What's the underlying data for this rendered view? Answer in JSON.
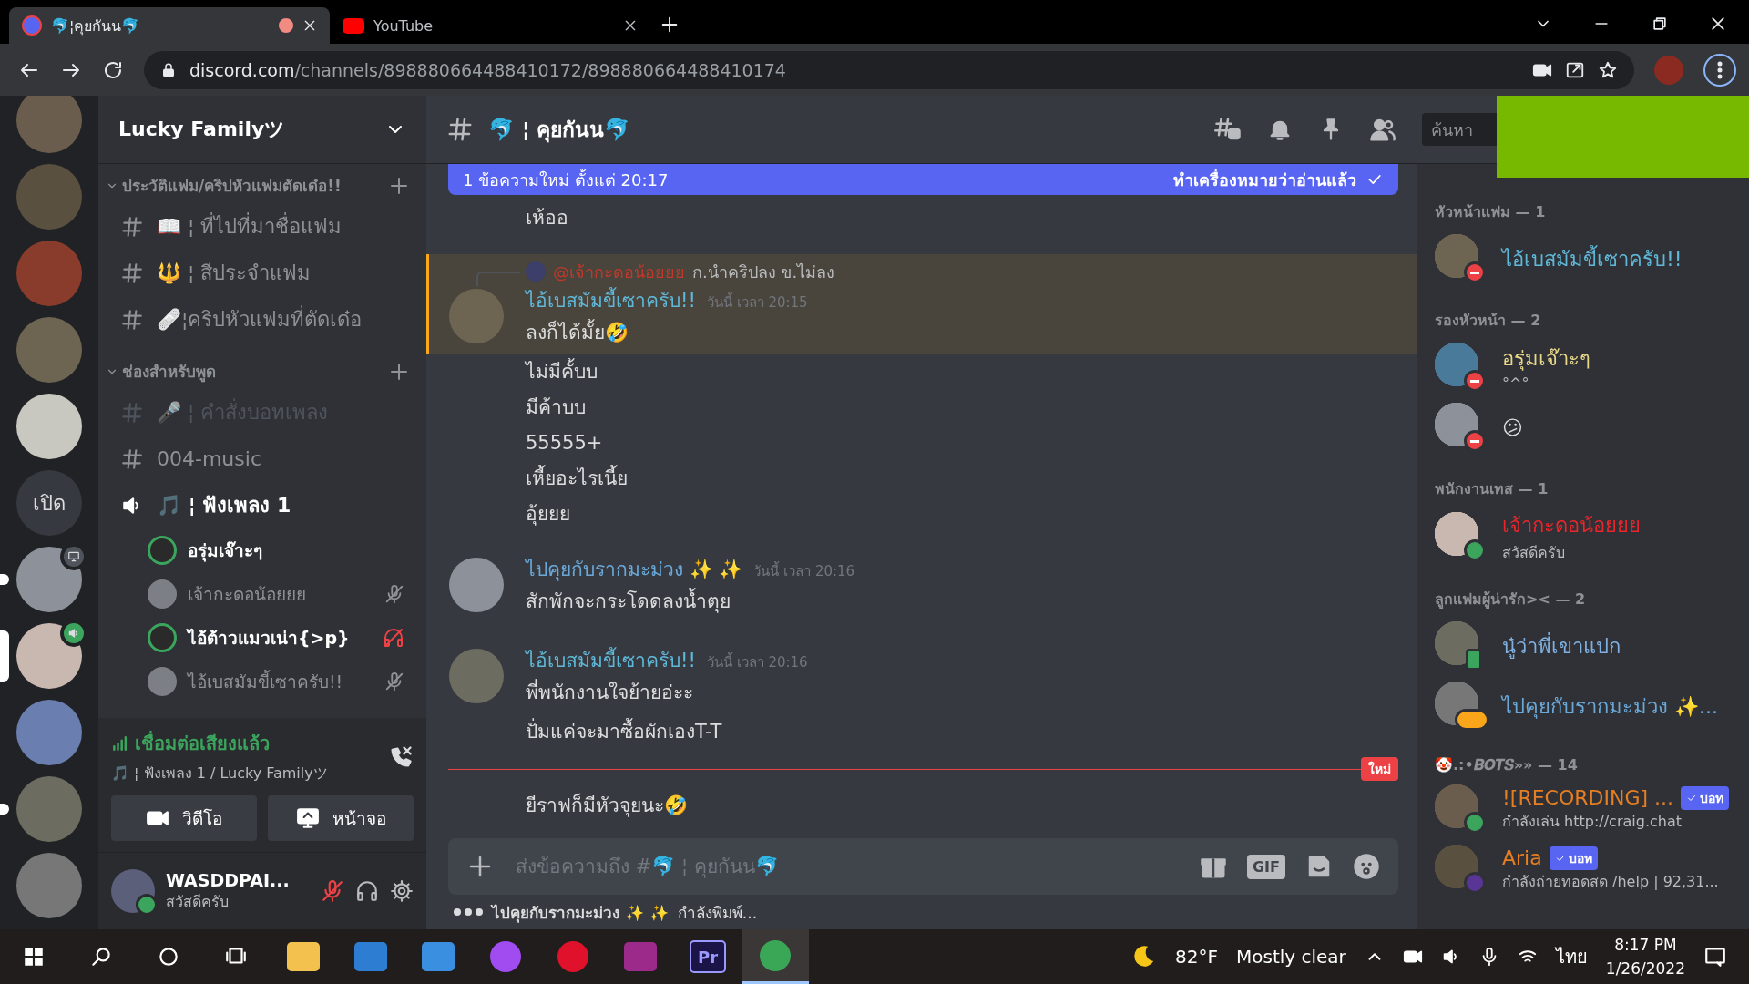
{
  "browser": {
    "tabs": [
      {
        "favicon": {
          "kind": "discord"
        },
        "title": "🐬¦คุยกันน🐬",
        "selected": true,
        "recording": true
      },
      {
        "favicon": {
          "kind": "youtube"
        },
        "title": "YouTube",
        "selected": false,
        "recording": false
      }
    ],
    "url": {
      "domain": "discord.com",
      "path": "/channels/898880664488410172/898880664488410174"
    }
  },
  "servers": [
    {
      "kind": "avatar",
      "unread": false,
      "selected": false
    },
    {
      "kind": "avatar",
      "unread": false,
      "selected": false
    },
    {
      "kind": "avatar",
      "unread": false,
      "selected": false
    },
    {
      "kind": "avatar",
      "unread": false,
      "selected": false
    },
    {
      "kind": "avatar",
      "unread": false,
      "selected": false
    },
    {
      "kind": "text",
      "label": "เปิด",
      "unread": false,
      "selected": false
    },
    {
      "kind": "avatar",
      "badge": {
        "kind": "screen"
      },
      "unread": true,
      "selected": false
    },
    {
      "kind": "avatar",
      "badge": {
        "kind": "voice"
      },
      "unread": false,
      "selected": true
    },
    {
      "kind": "avatar",
      "unread": false,
      "selected": false
    },
    {
      "kind": "avatar",
      "unread": true,
      "selected": false
    },
    {
      "kind": "avatar",
      "unread": false,
      "selected": false
    }
  ],
  "server": {
    "name": "Lucky Familyツ"
  },
  "categories": [
    {
      "name": "ประวัติแฟม/คริปหัวแฟมตัดเด๋อ!!",
      "expanded": true,
      "channels": [
        {
          "kind": "text",
          "name": "📖 ¦ ที่ไปที่มาชื่อแฟม",
          "muted": false
        },
        {
          "kind": "text",
          "name": "🔱 ¦ สีประจำแฟม",
          "muted": false
        },
        {
          "kind": "text",
          "name": "🩹¦คริปหัวแฟมที่ตัดเด๋อ",
          "muted": false
        }
      ]
    },
    {
      "name": "ช่องสำหรับพูด",
      "expanded": true,
      "channels": [
        {
          "kind": "text",
          "name": "🎤 ¦ คำสั่งบอทเพลง",
          "muted": true
        },
        {
          "kind": "text",
          "name": "004-music",
          "muted": false
        },
        {
          "kind": "voice",
          "name": "🎵 ¦ ฟังเพลง 1",
          "muted": false,
          "users": [
            {
              "name": "อรุ่มเจ๊าะๆ",
              "speaking": true,
              "muted": false,
              "deafened": false
            },
            {
              "name": "เจ้ากะดอน้อยยย",
              "speaking": false,
              "muted": true,
              "deafened": false
            },
            {
              "name": "ไอ้ต้าวแมวเน่า{>p}",
              "speaking": true,
              "muted": false,
              "deafened": true
            },
            {
              "name": "ไอ้เบสมัมขี้เซาครับ!!",
              "speaking": false,
              "muted": true,
              "deafened": false
            }
          ]
        }
      ]
    }
  ],
  "voice_connection": {
    "status": "เชื่อมต่อเสียงแล้ว",
    "channel": "🎵 ¦ ฟังเพลง 1 / Lucky Familyツ",
    "buttons": [
      {
        "kind": "video",
        "label": "วิดีโอ"
      },
      {
        "kind": "screen",
        "label": "หน้าจอ"
      }
    ]
  },
  "user_panel": {
    "name": "WASDDPAI...",
    "status_text": "สวัสดีครับ",
    "muted": true,
    "deafened": false
  },
  "channel_header": {
    "name": "🐬 ¦ คุยกันน🐬",
    "search_placeholder": "ค้นหา"
  },
  "new_messages_bar": {
    "text": "1 ข้อความใหม่ ตั้งแต่ 20:17",
    "action": "ทำเครื่องหมายว่าอ่านแล้ว"
  },
  "messages": [
    {
      "kind": "continuation",
      "lines": [
        "เห้ออ"
      ]
    },
    {
      "kind": "group",
      "mentioned": true,
      "reply": {
        "author": "@เจ้ากะดอน้อยยย",
        "text": "ก.นำคริปลง ข.ไม่ลง"
      },
      "author": "ไอ้เบสมัมขี้เซาครับ!!",
      "color": "#5fb8d8",
      "time": "วันนี้ เวลา 20:15",
      "lines": [
        "ลงก็ได้มั้ย🤣",
        "ไม่มีคั้บบ",
        "มีค้าบบ",
        "55555+",
        "เหี้ยอะไรเนี้ย",
        "อุ้ยยย"
      ]
    },
    {
      "kind": "group",
      "mentioned": false,
      "author": "ไปคุยกับรากมะม่วง ✨ ✨",
      "color": "#6aa8d8",
      "time": "วันนี้ เวลา 20:16",
      "lines": [
        "สักพักจะกระโดดลงน้ำตุย"
      ]
    },
    {
      "kind": "group",
      "mentioned": false,
      "author": "ไอ้เบสมัมขี้เซาครับ!!",
      "color": "#5fb8d8",
      "time": "วันนี้ เวลา 20:16",
      "lines": [
        "พี่พนักงานใจย้ายอ่ะะ",
        "ปั่มแค่จะมาซื้อผักเองT-T"
      ]
    },
    {
      "kind": "divider",
      "label": "ใหม่"
    },
    {
      "kind": "continuation",
      "lines": [
        "ยีราฟก็มีหัวจุยนะ🤣"
      ]
    }
  ],
  "composer": {
    "placeholder": "ส่งข้อความถึง #🐬 ¦ คุยกันน🐬",
    "gif_label": "GIF"
  },
  "typing": {
    "who": "ไปคุยกับรากมะม่วง ✨ ✨",
    "text": "กำลังพิมพ์..."
  },
  "member_groups": [
    {
      "title": "หัวหน้าแฟม — 1",
      "members": [
        {
          "name": "ไอ้เบสมัมขี้เซาครับ!!",
          "color": "#5fb8d8",
          "status": {
            "kind": "dnd"
          }
        }
      ]
    },
    {
      "title": "รองหัวหน้า — 2",
      "members": [
        {
          "name": "อรุ่มเจ๊าะๆ",
          "color": "#e8d888",
          "activity": "°^°",
          "status": {
            "kind": "dnd"
          }
        },
        {
          "name": "😕",
          "color": "#dcddde",
          "status": {
            "kind": "dnd"
          }
        }
      ]
    },
    {
      "title": "พนักงานเทส — 1",
      "members": [
        {
          "name": "เจ้ากะดอน้อยยย",
          "color": "#e8262b",
          "activity": "สวัสดีครับ",
          "status": {
            "kind": "online"
          }
        }
      ]
    },
    {
      "title": "ลูกแฟมผู้น่ารัก>< — 2",
      "members": [
        {
          "name": "นู๋ว่าพี่เขาแปก",
          "color": "#7fb0e0",
          "status": {
            "kind": "mobile"
          }
        },
        {
          "name": "ไปคุยกับรากมะม่วง ✨...",
          "color": "#6aa8d8",
          "status": {
            "kind": "typing"
          }
        }
      ]
    },
    {
      "title": "🤡.:•𝑩𝑶𝑻𝑺»» — 14",
      "members": [
        {
          "name": "![RECORDING] ...",
          "color": "#e67e22",
          "bot": "บอท",
          "activity": "กำลังเล่น http://craig.chat",
          "status": {
            "kind": "online"
          }
        },
        {
          "name": "Aria",
          "color": "#e67e22",
          "bot": "บอท",
          "activity": "กำลังถ่ายทอดสด /help | 92,31...",
          "status": {
            "kind": "streaming"
          }
        }
      ]
    }
  ],
  "taskbar": {
    "apps": [
      {
        "kind": "explorer",
        "active": false
      },
      {
        "kind": "store",
        "active": false
      },
      {
        "kind": "mail",
        "active": false
      },
      {
        "kind": "messenger",
        "active": false
      },
      {
        "kind": "opera",
        "active": false
      },
      {
        "kind": "archive",
        "active": false
      },
      {
        "kind": "premiere",
        "label": "Pr",
        "active": false
      },
      {
        "kind": "chrome",
        "active": true
      }
    ],
    "tray": {
      "temperature": "82°F",
      "weather": "Mostly clear",
      "language": "ไทย",
      "time": "8:17 PM",
      "date": "1/26/2022"
    }
  }
}
